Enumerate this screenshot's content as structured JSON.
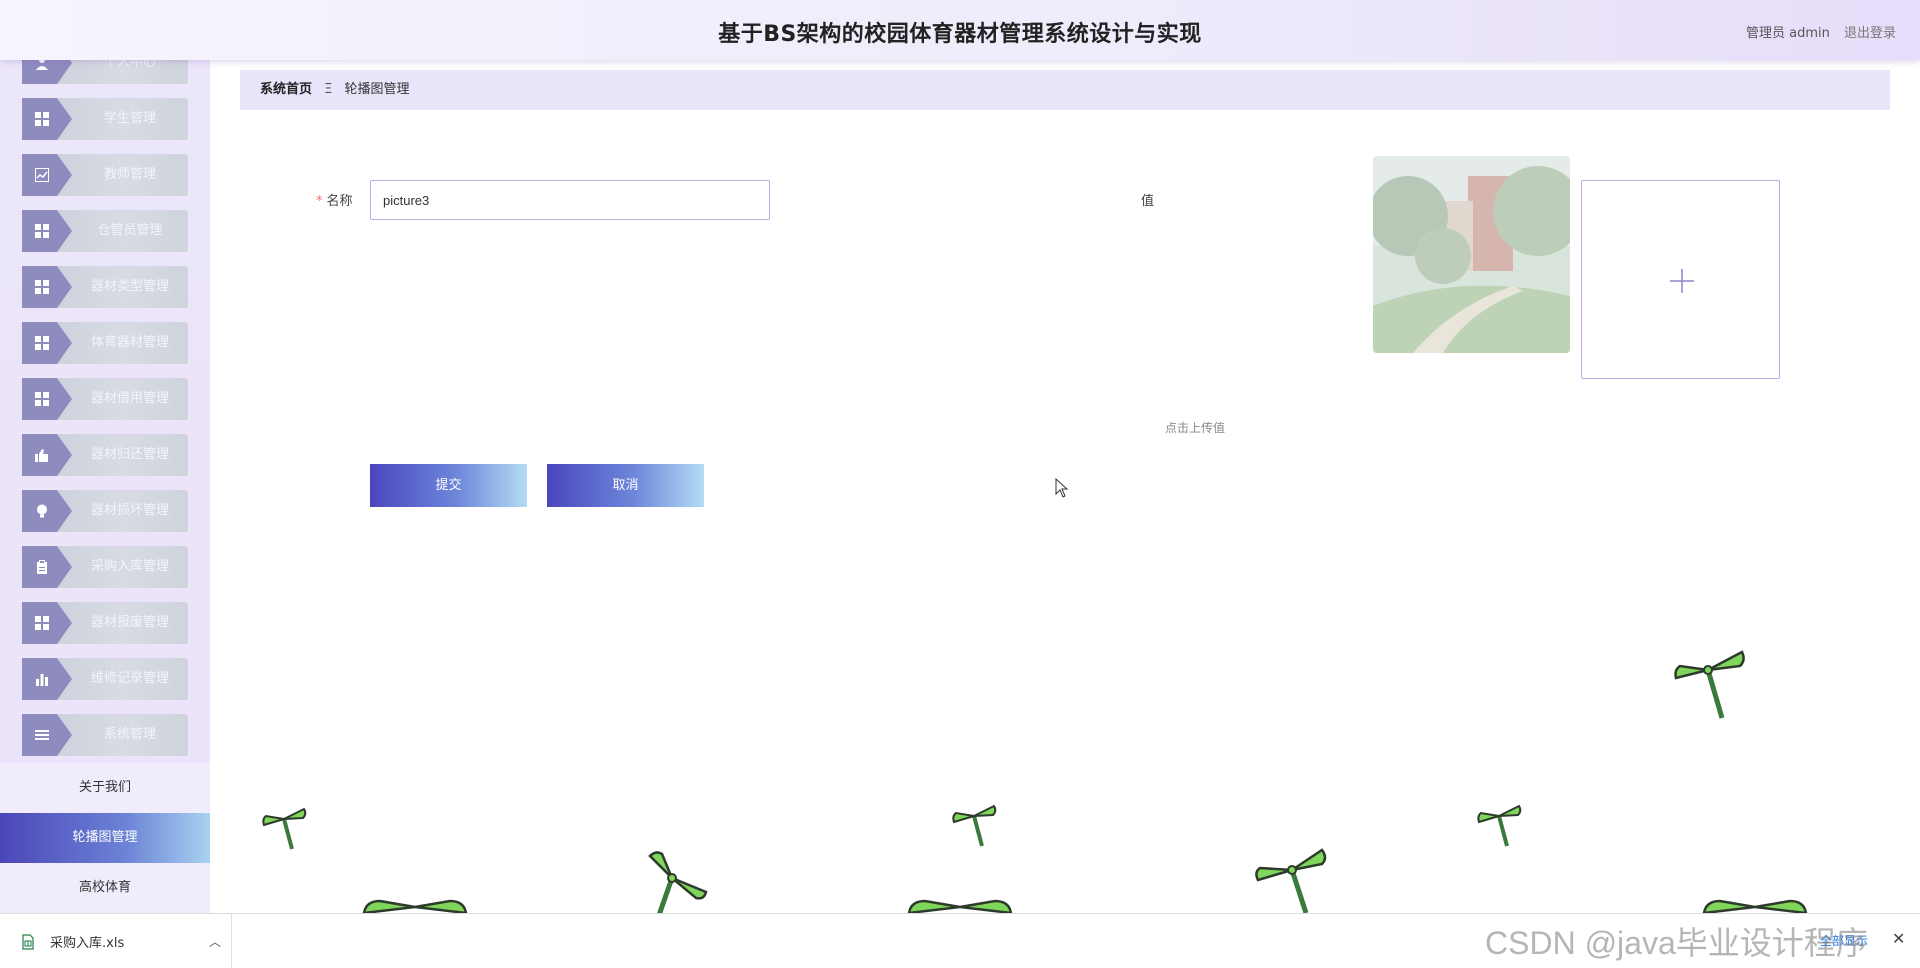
{
  "header": {
    "title": "基于BS架构的校园体育器材管理系统设计与实现",
    "user_label": "管理员 admin",
    "logout_label": "退出登录"
  },
  "sidebar": {
    "items": [
      {
        "label": "个人中心",
        "icon": "user-icon"
      },
      {
        "label": "学生管理",
        "icon": "grid-icon"
      },
      {
        "label": "教师管理",
        "icon": "chart-icon"
      },
      {
        "label": "仓管员管理",
        "icon": "grid-icon"
      },
      {
        "label": "器材类型管理",
        "icon": "grid-icon"
      },
      {
        "label": "体育器材管理",
        "icon": "grid-icon"
      },
      {
        "label": "器材借用管理",
        "icon": "grid-icon"
      },
      {
        "label": "器材归还管理",
        "icon": "thumb-icon"
      },
      {
        "label": "器材损坏管理",
        "icon": "bulb-icon"
      },
      {
        "label": "采购入库管理",
        "icon": "clipboard-icon"
      },
      {
        "label": "器材报废管理",
        "icon": "grid-icon"
      },
      {
        "label": "维修记录管理",
        "icon": "bar-chart-icon"
      },
      {
        "label": "系统管理",
        "icon": "list-icon"
      }
    ],
    "subitems": [
      {
        "label": "关于我们",
        "active": false
      },
      {
        "label": "轮播图管理",
        "active": true
      },
      {
        "label": "高校体育",
        "active": false
      }
    ]
  },
  "breadcrumb": {
    "home": "系统首页",
    "separator": "Ξ",
    "current": "轮播图管理"
  },
  "form": {
    "name_label": "名称",
    "name_value": "picture3",
    "value_label": "值",
    "upload_tip": "点击上传值",
    "submit_label": "提交",
    "cancel_label": "取消"
  },
  "download_bar": {
    "file_name": "采购入库.xls",
    "show_all_label": "全部显示"
  },
  "watermark": "CSDN @java毕业设计程序",
  "colors": {
    "accent": "#4b46b8",
    "header_bg": "#efebfb",
    "sidebar_bg": "#ece6fa",
    "propeller_green": "#7fd65a",
    "required": "#f56c6c"
  }
}
